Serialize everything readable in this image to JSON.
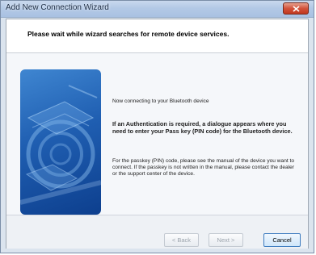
{
  "window": {
    "title": "Add New Connection Wizard"
  },
  "header": {
    "instruction": "Please wait while wizard searches for remote device services."
  },
  "content": {
    "status": "Now connecting to your Bluetooth device",
    "auth_notice": "If an Authentication is required, a dialogue appears where you need to enter your Pass key (PIN code) for the Bluetooth device.",
    "passkey_help": "For the passkey (PIN) code, please see the manual of the device you want to connect. If the passkey is not written in the manual, please contact the dealer or the support center of the device."
  },
  "buttons": {
    "back": "< Back",
    "next": "Next >",
    "cancel": "Cancel"
  },
  "colors": {
    "illustration_blue": "#1f5eb1",
    "titlebar": "#b3c9e6",
    "close_red": "#d2523a"
  }
}
